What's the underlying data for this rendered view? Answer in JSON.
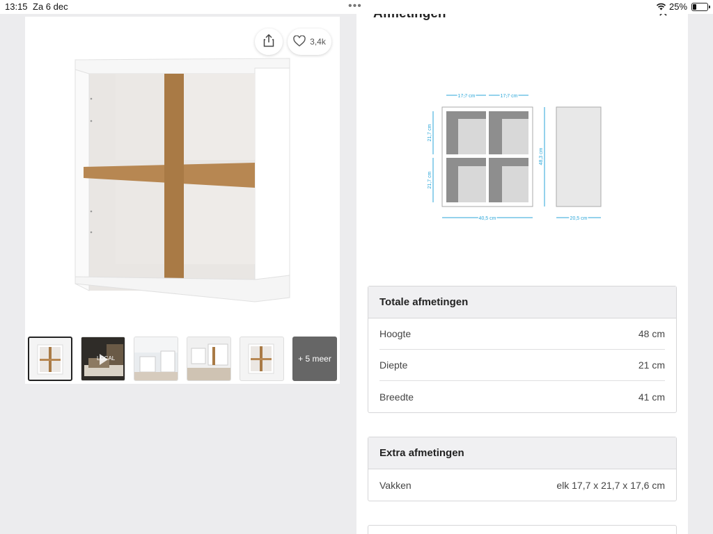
{
  "statusbar": {
    "time": "13:15",
    "date": "Za 6 dec",
    "battery_pct": "25%",
    "battery_level": 0.25
  },
  "gallery": {
    "like_count": "3,4k",
    "thumbs_more_label": "+ 5 meer",
    "video_label": "LOCAL"
  },
  "panel": {
    "title": "Afmetingen",
    "diagram": {
      "width_left": "17,7 cm",
      "width_right": "17,7 cm",
      "height_top": "21,7 cm",
      "height_bottom": "21,7 cm",
      "total_height": "48,3 cm",
      "total_width": "40,5 cm",
      "depth": "20,5 cm"
    },
    "total": {
      "heading": "Totale afmetingen",
      "rows": [
        {
          "label": "Hoogte",
          "value": "48 cm"
        },
        {
          "label": "Diepte",
          "value": "21 cm"
        },
        {
          "label": "Breedte",
          "value": "41 cm"
        }
      ]
    },
    "extra": {
      "heading": "Extra afmetingen",
      "rows": [
        {
          "label": "Vakken",
          "value": "elk 17,7 x 21,7 x 17,6 cm"
        }
      ]
    }
  },
  "colors": {
    "wood": "#a97a45",
    "white": "#ffffff",
    "dimension_blue": "#2aa6d9"
  }
}
